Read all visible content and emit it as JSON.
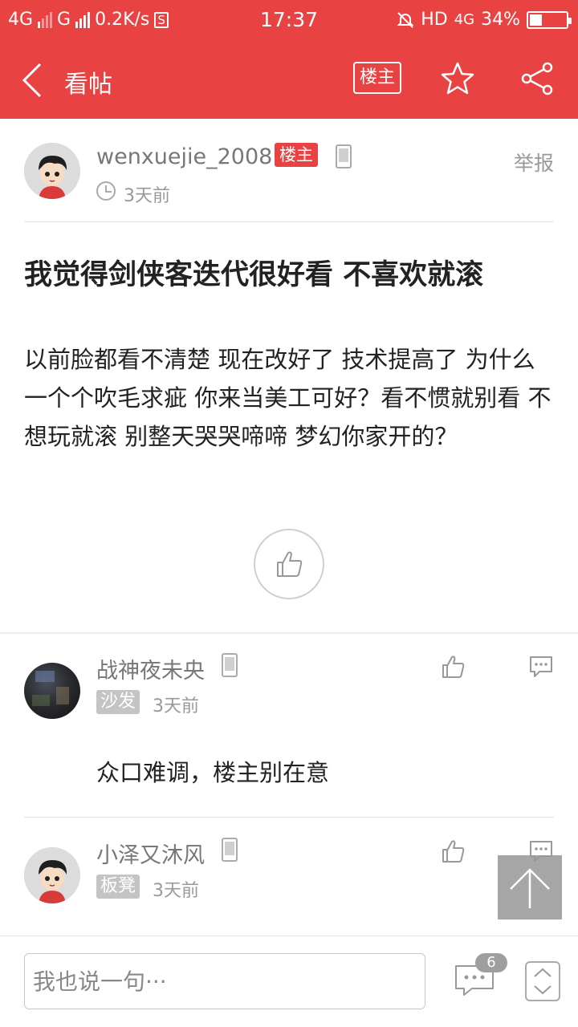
{
  "status_bar": {
    "network1": "4G",
    "network2": "G",
    "speed": "0.2K/s",
    "s_badge": "S",
    "time": "17:37",
    "hd": "HD",
    "net_right": "4G",
    "battery_percent": "34%",
    "battery_level": 0.34
  },
  "app_bar": {
    "title": "看帖",
    "louzhu_label": "楼主"
  },
  "post": {
    "author": "wenxuejie_2008",
    "author_badge": "楼主",
    "report": "举报",
    "time": "3天前",
    "title": "我觉得剑侠客迭代很好看 不喜欢就滚",
    "body": "以前脸都看不清楚 现在改好了 技术提高了 为什么一个个吹毛求疵 你来当美工可好？看不惯就别看 不想玩就滚 别整天哭哭啼啼 梦幻你家开的？"
  },
  "replies": [
    {
      "name": "战神夜未央",
      "floor": "沙发",
      "time": "3天前",
      "content": "众口难调，楼主别在意"
    },
    {
      "name": "小泽又沐风",
      "floor": "板凳",
      "time": "3天前",
      "content": ""
    }
  ],
  "bottom_bar": {
    "input_placeholder": "我也说一句···",
    "reply_count": "6"
  },
  "colors": {
    "brand_red": "#e84242"
  }
}
